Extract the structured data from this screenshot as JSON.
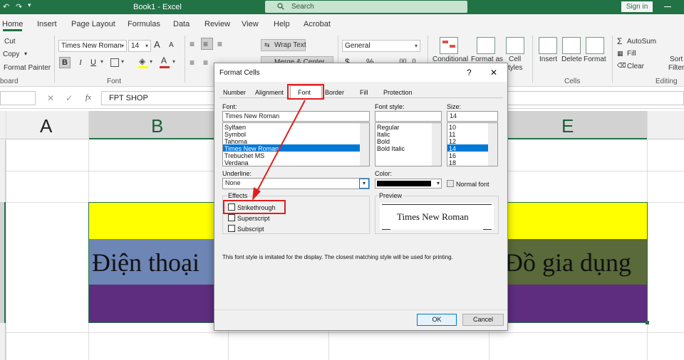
{
  "titlebar": {
    "title": "Book1  -  Excel",
    "search_placeholder": "Search",
    "signin": "Sign in"
  },
  "tabs": [
    "Home",
    "Insert",
    "Page Layout",
    "Formulas",
    "Data",
    "Review",
    "View",
    "Help",
    "Acrobat"
  ],
  "ribbon": {
    "clipboard": {
      "cut": "Cut",
      "copy": "Copy",
      "format_painter": "Format Painter",
      "label": "board"
    },
    "font": {
      "name": "Times New Roman",
      "size": "14",
      "grow": "A",
      "shrink": "A",
      "bold": "B",
      "italic": "I",
      "underline": "U",
      "label": "Font",
      "color_letter": "A"
    },
    "alignment": {
      "wrap_text": "Wrap Text",
      "merge_center": "Merge & Center"
    },
    "number": {
      "format": "General"
    },
    "styles": {
      "conditional": "Conditional",
      "format_as": "Format as",
      "cell": "Cell",
      "styles_suffix": "tyles"
    },
    "cells": {
      "insert": "Insert",
      "delete": "Delete",
      "format": "Format",
      "label": "Cells"
    },
    "editing": {
      "autosum": "AutoSum",
      "fill": "Fill",
      "clear": "Clear",
      "sort": "Sort",
      "filter": "Filter",
      "label": "Editing"
    }
  },
  "formula_bar": {
    "fx": "fx",
    "content": "FPT SHOP"
  },
  "columns": [
    "A",
    "B",
    "E"
  ],
  "cells": {
    "b_text": "Điện thoại",
    "e_text": "Đồ gia dụng"
  },
  "colors": {
    "yellow": "#ffff00",
    "blue": "#6e86b6",
    "olive": "#5a6a3a",
    "purple": "#5e2d80",
    "excel_green": "#217346"
  },
  "dialog": {
    "title": "Format Cells",
    "help": "?",
    "close": "✕",
    "tabs": [
      "Number",
      "Alignment",
      "Font",
      "Border",
      "Fill",
      "Protection"
    ],
    "font_label": "Font:",
    "font_value": "Times New Roman",
    "font_list": [
      "Sylfaen",
      "Symbol",
      "Tahoma",
      "Times New Roman",
      "Trebuchet MS",
      "Verdana"
    ],
    "style_label": "Font style:",
    "style_value": "",
    "style_list": [
      "Regular",
      "Italic",
      "Bold",
      "Bold Italic"
    ],
    "size_label": "Size:",
    "size_value": "14",
    "size_list": [
      "10",
      "11",
      "12",
      "14",
      "16",
      "18"
    ],
    "underline_label": "Underline:",
    "underline_value": "None",
    "color_label": "Color:",
    "normal_font": "Normal font",
    "effects_label": "Effects",
    "strikethrough": "Strikethrough",
    "superscript": "Superscript",
    "subscript": "Subscript",
    "preview_label": "Preview",
    "preview_text": "Times New Roman",
    "info": "This font style is imitated for the display.  The closest matching style will be used for printing.",
    "ok": "OK",
    "cancel": "Cancel"
  }
}
